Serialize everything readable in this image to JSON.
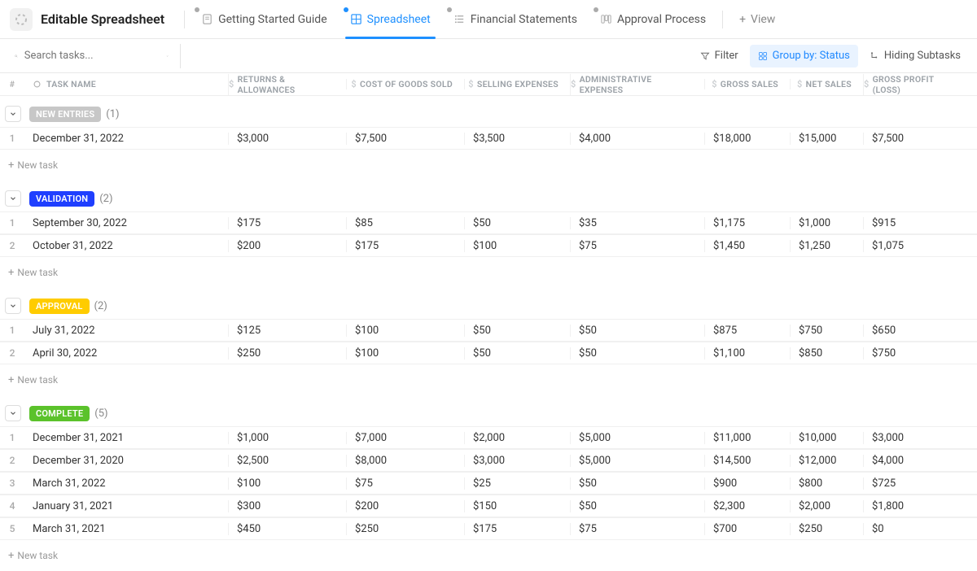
{
  "header": {
    "title": "Editable Spreadsheet",
    "tabs": [
      {
        "label": "Getting Started Guide",
        "icon": "doc"
      },
      {
        "label": "Spreadsheet",
        "icon": "grid",
        "active": true
      },
      {
        "label": "Financial Statements",
        "icon": "list"
      },
      {
        "label": "Approval Process",
        "icon": "board"
      }
    ],
    "view_label": "View"
  },
  "toolbar": {
    "search_placeholder": "Search tasks...",
    "filter_label": "Filter",
    "group_label": "Group by: Status",
    "hiding_label": "Hiding Subtasks"
  },
  "columns": {
    "num": "#",
    "name": "TASK NAME",
    "c1": "RETURNS & ALLOWANCES",
    "c2": "COST OF GOODS SOLD",
    "c3": "SELLING EXPENSES",
    "c4": "ADMINISTRATIVE EXPENSES",
    "c5": "GROSS SALES",
    "c6": "NET SALES",
    "c7": "GROSS PROFIT (LOSS)"
  },
  "groups": [
    {
      "status": "NEW ENTRIES",
      "color": "#c7c7c7",
      "count": "(1)",
      "rows": [
        {
          "n": "1",
          "name": "December 31, 2022",
          "c1": "$3,000",
          "c2": "$7,500",
          "c3": "$3,500",
          "c4": "$4,000",
          "c5": "$18,000",
          "c6": "$15,000",
          "c7": "$7,500"
        }
      ]
    },
    {
      "status": "VALIDATION",
      "color": "#1f3fff",
      "count": "(2)",
      "rows": [
        {
          "n": "1",
          "name": "September 30, 2022",
          "c1": "$175",
          "c2": "$85",
          "c3": "$50",
          "c4": "$35",
          "c5": "$1,175",
          "c6": "$1,000",
          "c7": "$915"
        },
        {
          "n": "2",
          "name": "October 31, 2022",
          "c1": "$200",
          "c2": "$175",
          "c3": "$100",
          "c4": "$75",
          "c5": "$1,450",
          "c6": "$1,250",
          "c7": "$1,075"
        }
      ]
    },
    {
      "status": "APPROVAL",
      "color": "#ffcc00",
      "count": "(2)",
      "rows": [
        {
          "n": "1",
          "name": "July 31, 2022",
          "c1": "$125",
          "c2": "$100",
          "c3": "$50",
          "c4": "$50",
          "c5": "$875",
          "c6": "$750",
          "c7": "$650"
        },
        {
          "n": "2",
          "name": "April 30, 2022",
          "c1": "$250",
          "c2": "$100",
          "c3": "$50",
          "c4": "$50",
          "c5": "$1,100",
          "c6": "$850",
          "c7": "$750"
        }
      ]
    },
    {
      "status": "COMPLETE",
      "color": "#5bc22b",
      "count": "(5)",
      "rows": [
        {
          "n": "1",
          "name": "December 31, 2021",
          "c1": "$1,000",
          "c2": "$7,000",
          "c3": "$2,000",
          "c4": "$5,000",
          "c5": "$11,000",
          "c6": "$10,000",
          "c7": "$3,000"
        },
        {
          "n": "2",
          "name": "December 31, 2020",
          "c1": "$2,500",
          "c2": "$8,000",
          "c3": "$3,000",
          "c4": "$5,000",
          "c5": "$14,500",
          "c6": "$12,000",
          "c7": "$4,000"
        },
        {
          "n": "3",
          "name": "March 31, 2022",
          "c1": "$100",
          "c2": "$75",
          "c3": "$25",
          "c4": "$50",
          "c5": "$900",
          "c6": "$800",
          "c7": "$725"
        },
        {
          "n": "4",
          "name": "January 31, 2021",
          "c1": "$300",
          "c2": "$200",
          "c3": "$150",
          "c4": "$50",
          "c5": "$2,300",
          "c6": "$2,000",
          "c7": "$1,800"
        },
        {
          "n": "5",
          "name": "March 31, 2021",
          "c1": "$450",
          "c2": "$250",
          "c3": "$175",
          "c4": "$75",
          "c5": "$700",
          "c6": "$250",
          "c7": "$0"
        }
      ]
    }
  ],
  "new_task_label": "New task"
}
